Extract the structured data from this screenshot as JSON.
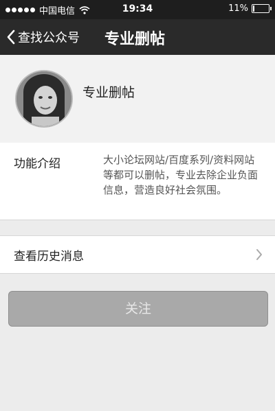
{
  "status_bar": {
    "carrier": "中国电信",
    "time": "19:34",
    "battery": "11%",
    "battery_level": 0.11
  },
  "nav": {
    "back_label": "查找公众号",
    "title": "专业删帖"
  },
  "profile": {
    "name": "专业删帖"
  },
  "intro": {
    "label": "功能介绍",
    "text": "大小论坛网站/百度系列/资料网站等都可以删帖，专业去除企业负面信息，营造良好社会氛围。"
  },
  "history": {
    "label": "查看历史消息"
  },
  "follow": {
    "label": "关注"
  },
  "icons": [
    "signal-icon",
    "wifi-icon",
    "battery-icon",
    "back-chevron-icon",
    "chevron-right-icon"
  ]
}
